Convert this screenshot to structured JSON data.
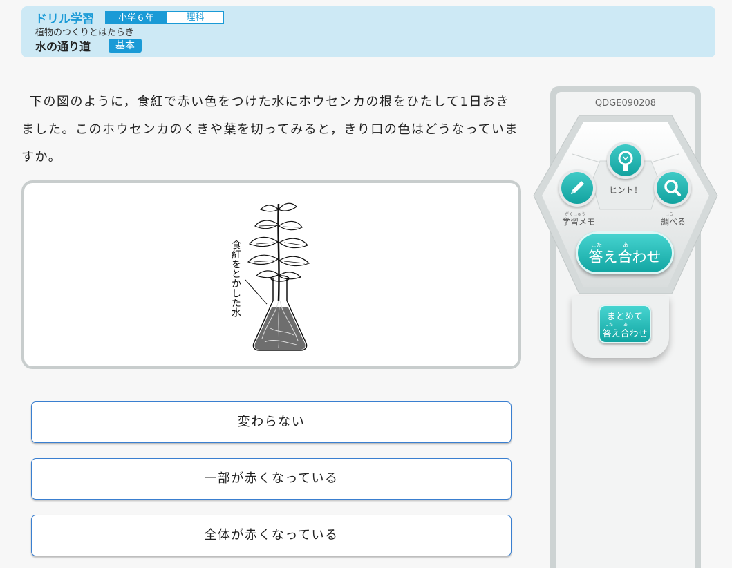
{
  "header": {
    "app_name": "ドリル学習",
    "grade": "小学６年",
    "subject": "理科",
    "unit": "植物のつくりとはたらき",
    "title": "水の通り道",
    "level": "基本"
  },
  "question": {
    "text": "下の図のように，食紅で赤い色をつけた水にホウセンカの根をひたして1日おきました。このホウセンカのくきや葉を切ってみると，きり口の色はどうなっていますか。"
  },
  "figure": {
    "label": "食紅をとかした水"
  },
  "choices": [
    {
      "label": "変わらない"
    },
    {
      "label": "一部が赤くなっている"
    },
    {
      "label": "全体が赤くなっている"
    }
  ],
  "panel": {
    "question_code": "QDGE090208",
    "hint_label": "ヒント！",
    "memo_label": "学習メモ",
    "memo_ruby": "がくしゅう",
    "lookup_label": "調べる",
    "lookup_ruby": "しら",
    "answer_label": "答え合わせ",
    "answer_ruby_1": "こた",
    "answer_ruby_2": "あ",
    "bulk_line1": "まとめて",
    "bulk_line2": "答え合わせ",
    "bulk_ruby_1": "こた",
    "bulk_ruby_2": "あ"
  },
  "colors": {
    "header_bg": "#cde9f5",
    "accent_blue": "#1a9ad6",
    "teal": "#12a29f",
    "choice_border": "#3a7fd0"
  },
  "icons": [
    "lightbulb-icon",
    "pencil-icon",
    "search-icon"
  ]
}
